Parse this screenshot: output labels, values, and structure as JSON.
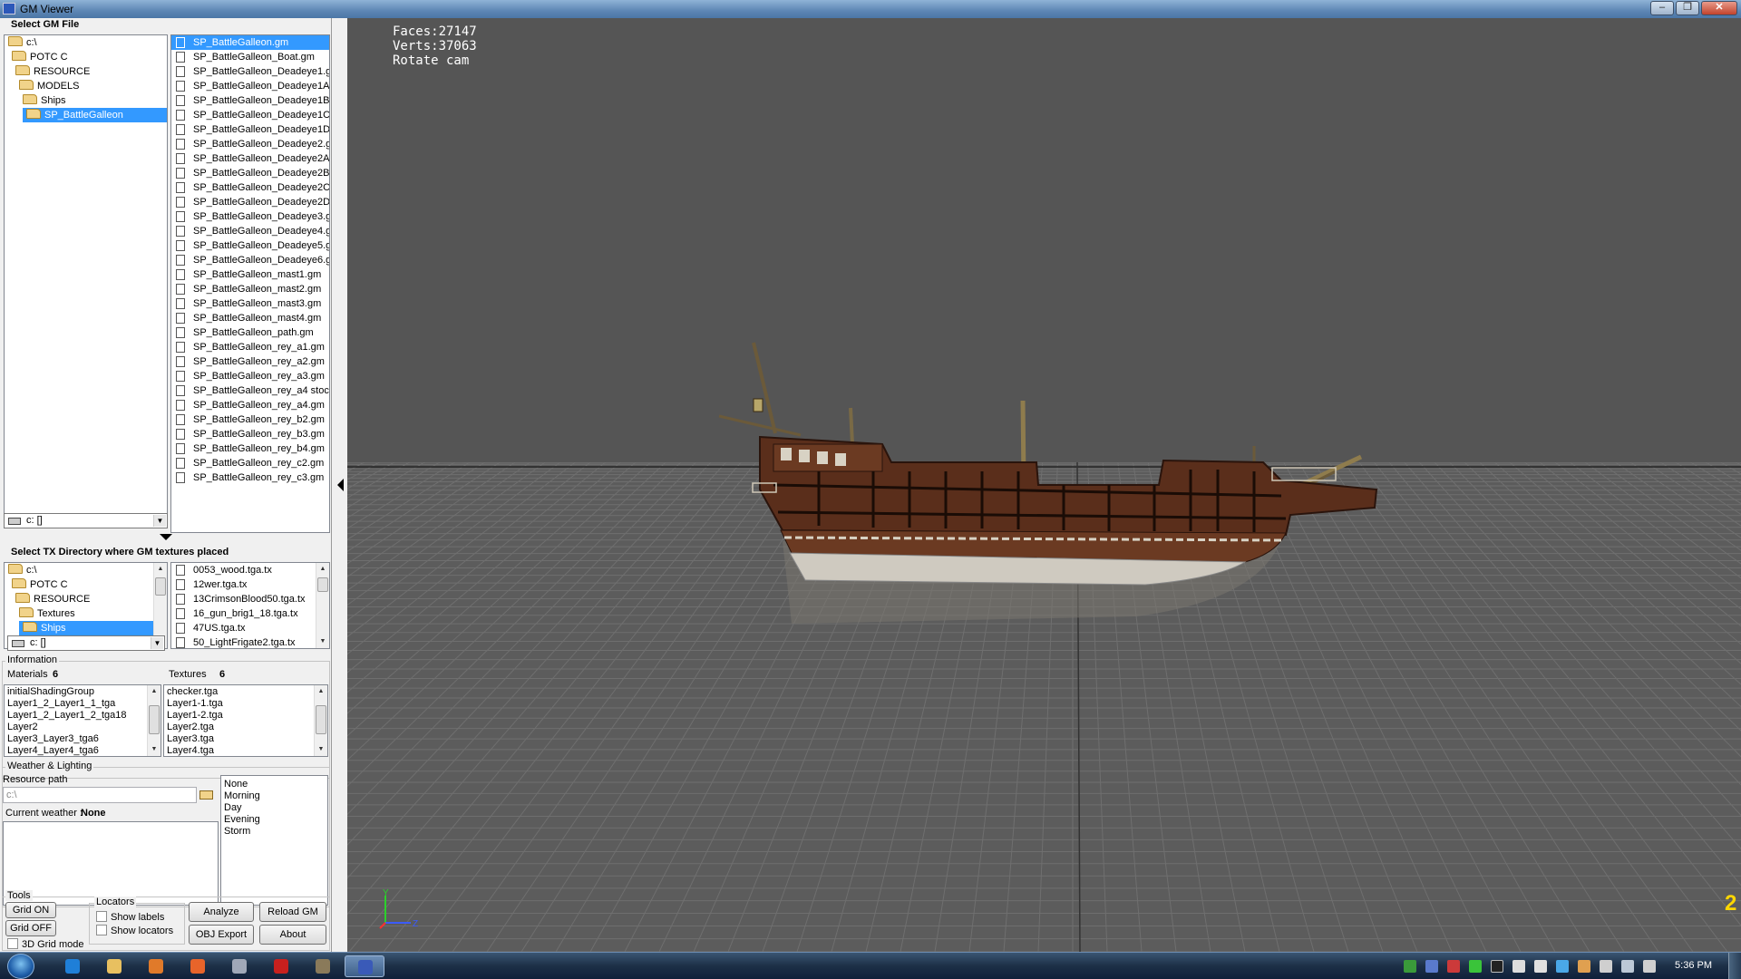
{
  "window": {
    "title": "GM Viewer"
  },
  "gm_file": {
    "section_title": "Select GM File",
    "tree": [
      {
        "label": "c:\\",
        "indent": 0,
        "selected": false
      },
      {
        "label": "POTC C",
        "indent": 1,
        "selected": false
      },
      {
        "label": "RESOURCE",
        "indent": 2,
        "selected": false
      },
      {
        "label": "MODELS",
        "indent": 3,
        "selected": false
      },
      {
        "label": "Ships",
        "indent": 4,
        "selected": false
      },
      {
        "label": "SP_BattleGalleon",
        "indent": 5,
        "selected": true
      }
    ],
    "drive": "c: []",
    "files": [
      "SP_BattleGalleon.gm",
      "SP_BattleGalleon_Boat.gm",
      "SP_BattleGalleon_Deadeye1.gr",
      "SP_BattleGalleon_Deadeye1A.g",
      "SP_BattleGalleon_Deadeye1B.g",
      "SP_BattleGalleon_Deadeye1C.g",
      "SP_BattleGalleon_Deadeye1D.g",
      "SP_BattleGalleon_Deadeye2.gr",
      "SP_BattleGalleon_Deadeye2A.g",
      "SP_BattleGalleon_Deadeye2B.g",
      "SP_BattleGalleon_Deadeye2C.g",
      "SP_BattleGalleon_Deadeye2D.g",
      "SP_BattleGalleon_Deadeye3.gr",
      "SP_BattleGalleon_Deadeye4.gr",
      "SP_BattleGalleon_Deadeye5.gr",
      "SP_BattleGalleon_Deadeye6.gr",
      "SP_BattleGalleon_mast1.gm",
      "SP_BattleGalleon_mast2.gm",
      "SP_BattleGalleon_mast3.gm",
      "SP_BattleGalleon_mast4.gm",
      "SP_BattleGalleon_path.gm",
      "SP_BattleGalleon_rey_a1.gm",
      "SP_BattleGalleon_rey_a2.gm",
      "SP_BattleGalleon_rey_a3.gm",
      "SP_BattleGalleon_rey_a4 stock",
      "SP_BattleGalleon_rey_a4.gm",
      "SP_BattleGalleon_rey_b2.gm",
      "SP_BattleGalleon_rey_b3.gm",
      "SP_BattleGalleon_rey_b4.gm",
      "SP_BattleGalleon_rey_c2.gm",
      "SP_BattleGalleon_rey_c3.gm"
    ],
    "selected_file": 0
  },
  "tx_dir": {
    "section_title": "Select TX Directory where GM textures placed",
    "tree": [
      {
        "label": "c:\\",
        "indent": 0,
        "selected": false
      },
      {
        "label": "POTC C",
        "indent": 1,
        "selected": false
      },
      {
        "label": "RESOURCE",
        "indent": 2,
        "selected": false
      },
      {
        "label": "Textures",
        "indent": 3,
        "selected": false
      },
      {
        "label": "Ships",
        "indent": 4,
        "selected": true
      }
    ],
    "drive": "c: []",
    "files": [
      "0053_wood.tga.tx",
      "12wer.tga.tx",
      "13CrimsonBlood50.tga.tx",
      "16_gun_brig1_18.tga.tx",
      "47US.tga.tx",
      "50_LightFrigate2.tga.tx"
    ]
  },
  "information": {
    "group_label": "Information",
    "materials_label": "Materials",
    "materials_count": "6",
    "textures_label": "Textures",
    "textures_count": "6",
    "materials": [
      "initialShadingGroup",
      "Layer1_2_Layer1_1_tga",
      "Layer1_2_Layer1_2_tga18",
      "Layer2",
      "Layer3_Layer3_tga6",
      "Layer4_Layer4_tga6"
    ],
    "textures": [
      "checker.tga",
      "Layer1-1.tga",
      "Layer1-2.tga",
      "Layer2.tga",
      "Layer3.tga",
      "Layer4.tga"
    ]
  },
  "weather": {
    "group_label": "Weather & Lighting",
    "resource_path_label": "Resource path",
    "resource_path_placeholder": "c:\\",
    "current_weather_label": "Current weather :",
    "current_weather_value": "None",
    "options": [
      "None",
      "Morning",
      "Day",
      "Evening",
      "Storm"
    ]
  },
  "tools": {
    "group_label": "Tools",
    "grid_on": "Grid ON",
    "grid_off": "Grid OFF",
    "grid_mode": "3D Grid mode",
    "locators_label": "Locators",
    "show_labels": "Show labels",
    "show_locators": "Show locators",
    "analyze": "Analyze",
    "reload": "Reload GM",
    "obj_export": "OBJ Export",
    "about": "About"
  },
  "viewport": {
    "hud": [
      "Faces:27147",
      "Verts:37063",
      "Rotate cam"
    ],
    "background": "#555555",
    "grid_color": "#6f6f6f",
    "axis_y_label": "Y",
    "axis_z_label": "Z",
    "corner_badge": "2"
  },
  "taskbar": {
    "clock": "5:36 PM",
    "pinned": [
      "ie-icon",
      "explorer-icon",
      "media-player-icon",
      "firefox-icon",
      "tool-icon",
      "h-app-icon",
      "gimp-icon",
      "gm-viewer-icon"
    ],
    "active_index": 7
  },
  "colors": {
    "selection": "#3399ff",
    "hull_dark": "#4a2718",
    "hull_mid": "#6b3a22",
    "hull_light": "#c9c3b4"
  }
}
